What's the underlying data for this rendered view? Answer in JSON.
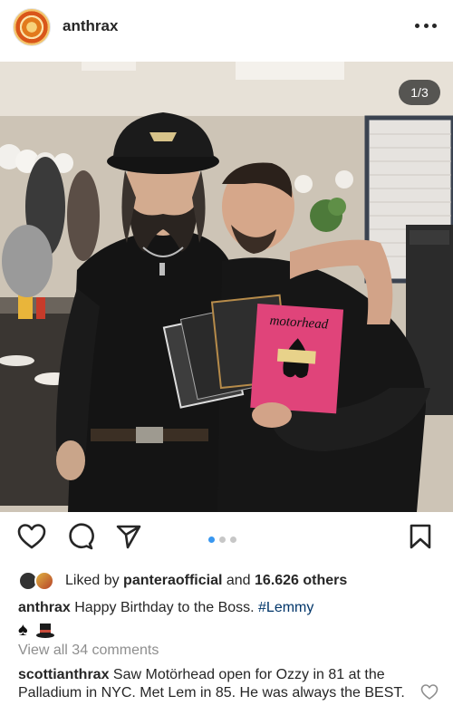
{
  "post": {
    "username": "anthrax",
    "image_counter": "1/3",
    "carousel": {
      "total": 3,
      "active_index": 0
    }
  },
  "likes": {
    "prefix": "Liked by",
    "first_liker": "panteraofficial",
    "and_text": "and",
    "others": "16.626 others"
  },
  "caption": {
    "username": "anthrax",
    "text": "Happy Birthday to the Boss.",
    "hashtag": "#Lemmy",
    "emojis": [
      "spade-emoji",
      "top-hat-emoji"
    ]
  },
  "view_comments": "View all 34 comments",
  "comment": {
    "username": "scottianthrax",
    "text": "Saw Motörhead open for Ozzy in 81 at the Palladium in NYC. Met Lem in 85. He was always the BEST."
  },
  "colors": {
    "accent_blue": "#3897f0",
    "hashtag": "#003569",
    "muted": "#8e8e8e"
  },
  "photo_album_text": "motorhead"
}
